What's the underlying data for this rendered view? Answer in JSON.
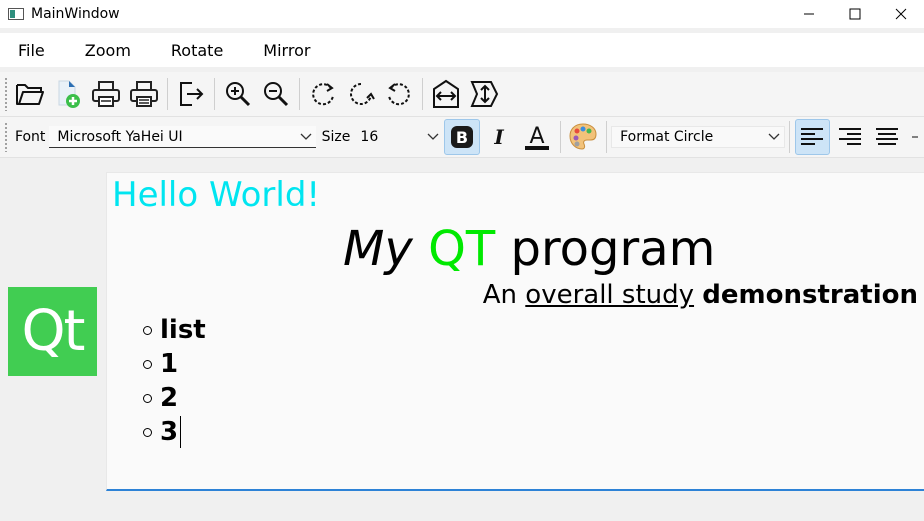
{
  "window": {
    "title": "MainWindow",
    "minimize": "—",
    "maximize": "☐",
    "close": "✕"
  },
  "menu": {
    "items": [
      "File",
      "Zoom",
      "Rotate",
      "Mirror"
    ]
  },
  "toolbar": {
    "icons": [
      "open-folder-icon",
      "new-file-icon",
      "print-icon",
      "print-preview-icon",
      "exit-icon",
      "zoom-in-icon",
      "zoom-out-icon",
      "rotate-90-icon",
      "rotate-180-icon",
      "rotate-270-icon",
      "mirror-horizontal-icon",
      "mirror-vertical-icon"
    ]
  },
  "format_bar": {
    "font_label": "Font",
    "font_value": "Microsoft YaHei UI",
    "size_label": "Size",
    "size_value": "16",
    "format_value": "Format Circle",
    "bold_active": true,
    "align_left_active": true,
    "colors": {
      "accent_active": "#cde4f7",
      "text_color_underline": "#000000"
    }
  },
  "document": {
    "hello": "Hello World!",
    "heading": {
      "my": "My",
      "qt": "QT",
      "program": "program"
    },
    "subline": {
      "an": "An",
      "overall": "overall study",
      "demo": "demonstration"
    },
    "list": [
      "list",
      "1",
      "2",
      "3"
    ],
    "colors": {
      "hello": "#00e5f0",
      "qt": "#00e900",
      "focus_border": "#2d82d6"
    }
  },
  "logo": {
    "text": "Qt",
    "color": "#41cd52"
  }
}
